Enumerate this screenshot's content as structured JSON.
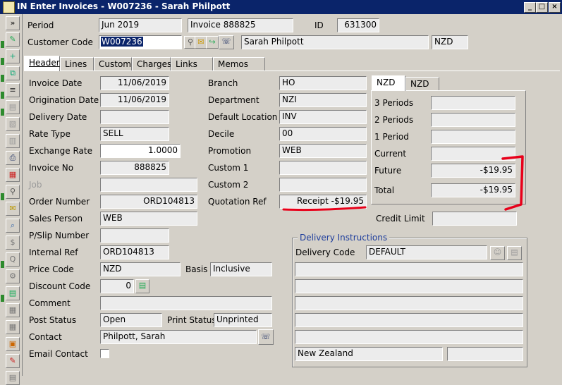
{
  "window": {
    "title": "IN Enter Invoices - W007236 - Sarah Philpott"
  },
  "top": {
    "period_label": "Period",
    "period_value": "Jun 2019",
    "invoice_display": "Invoice 888825",
    "id_label": "ID",
    "id_value": "631300",
    "customer_code_label": "Customer Code",
    "customer_code_value": "W007236",
    "customer_name": "Sarah Philpott",
    "currency": "NZD"
  },
  "tabs": [
    "Header",
    "Lines",
    "Custom",
    "Charges",
    "Links",
    "Memos"
  ],
  "left": {
    "invoice_date_label": "Invoice Date",
    "invoice_date": "11/06/2019",
    "origination_date_label": "Origination Date",
    "origination_date": "11/06/2019",
    "delivery_date_label": "Delivery Date",
    "delivery_date": "",
    "rate_type_label": "Rate Type",
    "rate_type": "SELL",
    "exchange_rate_label": "Exchange Rate",
    "exchange_rate": "1.0000",
    "invoice_no_label": "Invoice No",
    "invoice_no": "888825",
    "job_label": "Job",
    "job": "",
    "order_number_label": "Order Number",
    "order_number": "ORD104813",
    "sales_person_label": "Sales Person",
    "sales_person": "WEB",
    "pslip_label": "P/Slip Number",
    "pslip": "",
    "internal_ref_label": "Internal Ref",
    "internal_ref": "ORD104813",
    "price_code_label": "Price Code",
    "price_code": "NZD",
    "basis_label": "Basis",
    "basis": "Inclusive",
    "discount_code_label": "Discount Code",
    "discount_code": "0",
    "comment_label": "Comment",
    "comment": "",
    "post_status_label": "Post Status",
    "post_status": "Open",
    "print_status_label": "Print Status",
    "print_status": "Unprinted",
    "contact_label": "Contact",
    "contact": "Philpott, Sarah",
    "email_contact_label": "Email Contact"
  },
  "middle": {
    "branch_label": "Branch",
    "branch": "HO",
    "department_label": "Department",
    "department": "NZI",
    "default_location_label": "Default Location",
    "default_location": "INV",
    "decile_label": "Decile",
    "decile": "00",
    "promotion_label": "Promotion",
    "promotion": "WEB",
    "custom1_label": "Custom 1",
    "custom1": "",
    "custom2_label": "Custom 2",
    "custom2": "",
    "quotation_ref_label": "Quotation Ref",
    "quotation_ref": "Receipt -$19.95"
  },
  "aging": {
    "tabs": [
      "NZD",
      "NZD"
    ],
    "three_periods_label": "3 Periods",
    "two_periods_label": "2 Periods",
    "one_period_label": "1 Period",
    "current_label": "Current",
    "future_label": "Future",
    "future_value": "-$19.95",
    "total_label": "Total",
    "total_value": "-$19.95",
    "credit_limit_label": "Credit Limit"
  },
  "delivery": {
    "group_label": "Delivery Instructions",
    "delivery_code_label": "Delivery Code",
    "delivery_code": "DEFAULT",
    "country": "New Zealand"
  },
  "colors": {
    "titlebar": "#0a246a",
    "annotation": "#e8001a",
    "background": "#d4d0c8"
  }
}
